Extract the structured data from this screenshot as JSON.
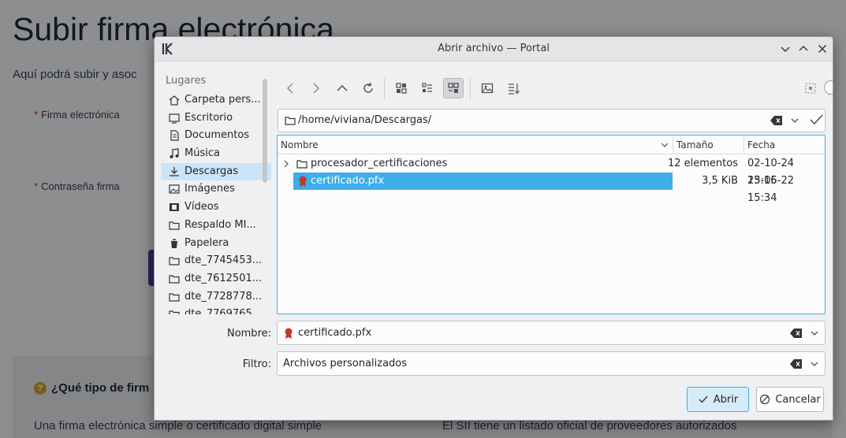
{
  "background": {
    "title": "Subir firma electrónica",
    "subtitle": "Aquí podrá subir y asoc",
    "label_firma": "Firma electrónica",
    "label_contrasena": "Contraseña firma",
    "required_mark": "*",
    "question": "¿Qué tipo de firm",
    "question_icon": "?",
    "para_left": "Una firma electrónica simple o certificado digital simple",
    "para_right": "El SII tiene un listado oficial de proveedores autorizados"
  },
  "dialog": {
    "title": "Abrir archivo — Portal",
    "sidebar": {
      "heading": "Lugares",
      "items": [
        {
          "label": "Carpeta pers...",
          "icon": "home-icon"
        },
        {
          "label": "Escritorio",
          "icon": "desktop-icon"
        },
        {
          "label": "Documentos",
          "icon": "documents-icon"
        },
        {
          "label": "Música",
          "icon": "music-icon"
        },
        {
          "label": "Descargas",
          "icon": "downloads-icon"
        },
        {
          "label": "Imágenes",
          "icon": "pictures-icon"
        },
        {
          "label": "Vídeos",
          "icon": "videos-icon"
        },
        {
          "label": "Respaldo MI...",
          "icon": "folder-icon"
        },
        {
          "label": "Papelera",
          "icon": "trash-icon"
        },
        {
          "label": "dte_7745453...",
          "icon": "folder-icon"
        },
        {
          "label": "dte_7612501...",
          "icon": "folder-icon"
        },
        {
          "label": "dte_7728778...",
          "icon": "folder-icon"
        },
        {
          "label": "dte_7769765",
          "icon": "folder-icon"
        }
      ],
      "selected_index": 4
    },
    "path": "/home/viviana/Descargas/",
    "columns": {
      "name": "Nombre",
      "size": "Tamaño",
      "date": "Fecha"
    },
    "files": [
      {
        "name": "procesador_certificaciones",
        "size": "12 elementos",
        "date": "02-10-24 15:16",
        "type": "folder"
      },
      {
        "name": "certificado.pfx",
        "size": "3,5 KiB",
        "date": "23-05-22 15:34",
        "type": "certificate"
      }
    ],
    "name_label": "Nombre:",
    "name_value": "certificado.pfx",
    "filter_label": "Filtro:",
    "filter_value": "Archivos personalizados",
    "open_label": "Abrir",
    "cancel_label": "Cancelar",
    "accent_color": "#3daee9"
  }
}
